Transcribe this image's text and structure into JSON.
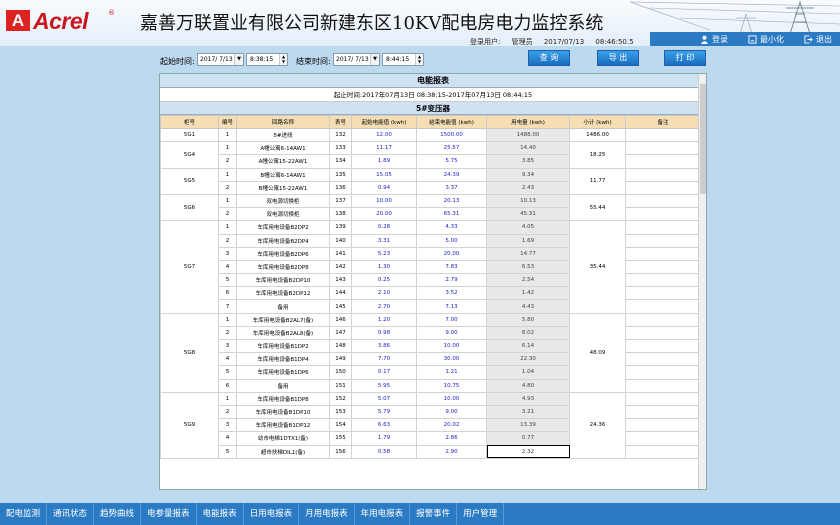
{
  "app": {
    "logo": "Acrel",
    "logo_mark": "A",
    "logo_reg": "®",
    "title": "嘉善万联置业有限公司新建东区10KV配电房电力监控系统"
  },
  "user": {
    "label": "登录用户:",
    "name": "管理员",
    "date": "2017/07/13",
    "time": "08:46:50.5"
  },
  "top_buttons": [
    {
      "label": "登录",
      "icon": "user-icon"
    },
    {
      "label": "最小化",
      "icon": "minimize-icon"
    },
    {
      "label": "退出",
      "icon": "exit-icon"
    }
  ],
  "filters": {
    "start_label": "起始时间:",
    "start_date": "2017/ 7/13",
    "start_time": "8:38:15",
    "end_label": "结束时间:",
    "end_date": "2017/ 7/13",
    "end_time": "8:44:15"
  },
  "actions": {
    "query": "查 询",
    "export": "导 出",
    "print": "打 印"
  },
  "report": {
    "title": "电能报表",
    "period": "起止时间:2017年07月13日 08:38:15-2017年07月13日 08:44:15",
    "subtitle": "5#变压器",
    "headers": [
      "柜号",
      "编号",
      "回路名称",
      "表号",
      "起始电能值 (kwh)",
      "结束电能值 (kwh)",
      "用电量 (kwh)",
      "小计 (kwh)",
      "备注"
    ],
    "groups": [
      {
        "cabinet": "5G1",
        "subtotal": "1486.00",
        "rows": [
          [
            "1",
            "5#进线",
            "132",
            "12.00",
            "1500.00",
            "1488.00"
          ]
        ]
      },
      {
        "cabinet": "5G4",
        "subtotal": "18.25",
        "rows": [
          [
            "1",
            "A幢公寓6-14AW1",
            "133",
            "11.17",
            "25.57",
            "14.40"
          ],
          [
            "2",
            "A幢公寓15-22AW1",
            "134",
            "1.89",
            "5.75",
            "3.85"
          ]
        ]
      },
      {
        "cabinet": "5G5",
        "subtotal": "11.77",
        "rows": [
          [
            "1",
            "B幢公寓6-14AW1",
            "135",
            "15.05",
            "24.39",
            "9.34"
          ],
          [
            "2",
            "B幢公寓15-22AW1",
            "136",
            "0.94",
            "3.37",
            "2.43"
          ]
        ]
      },
      {
        "cabinet": "5G6",
        "subtotal": "55.44",
        "rows": [
          [
            "1",
            "双电源切换柜",
            "137",
            "10.00",
            "20.13",
            "10.13"
          ],
          [
            "2",
            "双电源切换柜",
            "138",
            "20.00",
            "65.31",
            "45.31"
          ]
        ]
      },
      {
        "cabinet": "5G7",
        "subtotal": "35.44",
        "rows": [
          [
            "1",
            "车库用电设备B2DP2",
            "139",
            "0.28",
            "4.33",
            "4.05"
          ],
          [
            "2",
            "车库用电设备B2DP4",
            "140",
            "3.31",
            "5.00",
            "1.69"
          ],
          [
            "3",
            "车库用电设备B2DP6",
            "141",
            "5.23",
            "20.00",
            "14.77"
          ],
          [
            "4",
            "车库用电设备B2DP8",
            "142",
            "1.30",
            "7.83",
            "6.53"
          ],
          [
            "5",
            "车库用电设备B2DP10",
            "143",
            "0.25",
            "2.79",
            "2.54"
          ],
          [
            "6",
            "车库用电设备B2DP12",
            "144",
            "2.10",
            "3.52",
            "1.42"
          ],
          [
            "7",
            "备用",
            "145",
            "2.70",
            "7.13",
            "4.43"
          ]
        ]
      },
      {
        "cabinet": "5G8",
        "subtotal": "48.09",
        "rows": [
          [
            "1",
            "车库用电设备B2AL7(备)",
            "146",
            "1.20",
            "7.00",
            "5.80"
          ],
          [
            "2",
            "车库用电设备B2AL8(备)",
            "147",
            "0.98",
            "9.00",
            "8.02"
          ],
          [
            "3",
            "车库用电设备B1DP2",
            "148",
            "3.86",
            "10.00",
            "6.14"
          ],
          [
            "4",
            "车库用电设备B1DP4",
            "149",
            "7.70",
            "30.00",
            "22.30"
          ],
          [
            "5",
            "车库用电设备B1DP6",
            "150",
            "0.17",
            "1.21",
            "1.04"
          ],
          [
            "6",
            "备用",
            "151",
            "5.95",
            "10.75",
            "4.80"
          ]
        ]
      },
      {
        "cabinet": "5G9",
        "subtotal": "24.36",
        "rows": [
          [
            "1",
            "车库用电设备B1DP8",
            "152",
            "5.07",
            "10.00",
            "4.93"
          ],
          [
            "2",
            "车库用电设备B1DP10",
            "153",
            "5.79",
            "9.00",
            "3.21"
          ],
          [
            "3",
            "车库用电设备B1DP12",
            "154",
            "6.63",
            "20.02",
            "13.39"
          ],
          [
            "4",
            "幼市电梯1DTX1(备)",
            "155",
            "1.79",
            "2.86",
            "0.77"
          ],
          [
            "5",
            "超市扶梯DIL1(备)",
            "156",
            "0.58",
            "2.90",
            "2.32"
          ]
        ]
      }
    ]
  },
  "nav": [
    "配电监测",
    "通讯状态",
    "趋势曲线",
    "电参量报表",
    "电能报表",
    "日用电报表",
    "月用电报表",
    "年用电报表",
    "报警事件",
    "用户管理"
  ]
}
